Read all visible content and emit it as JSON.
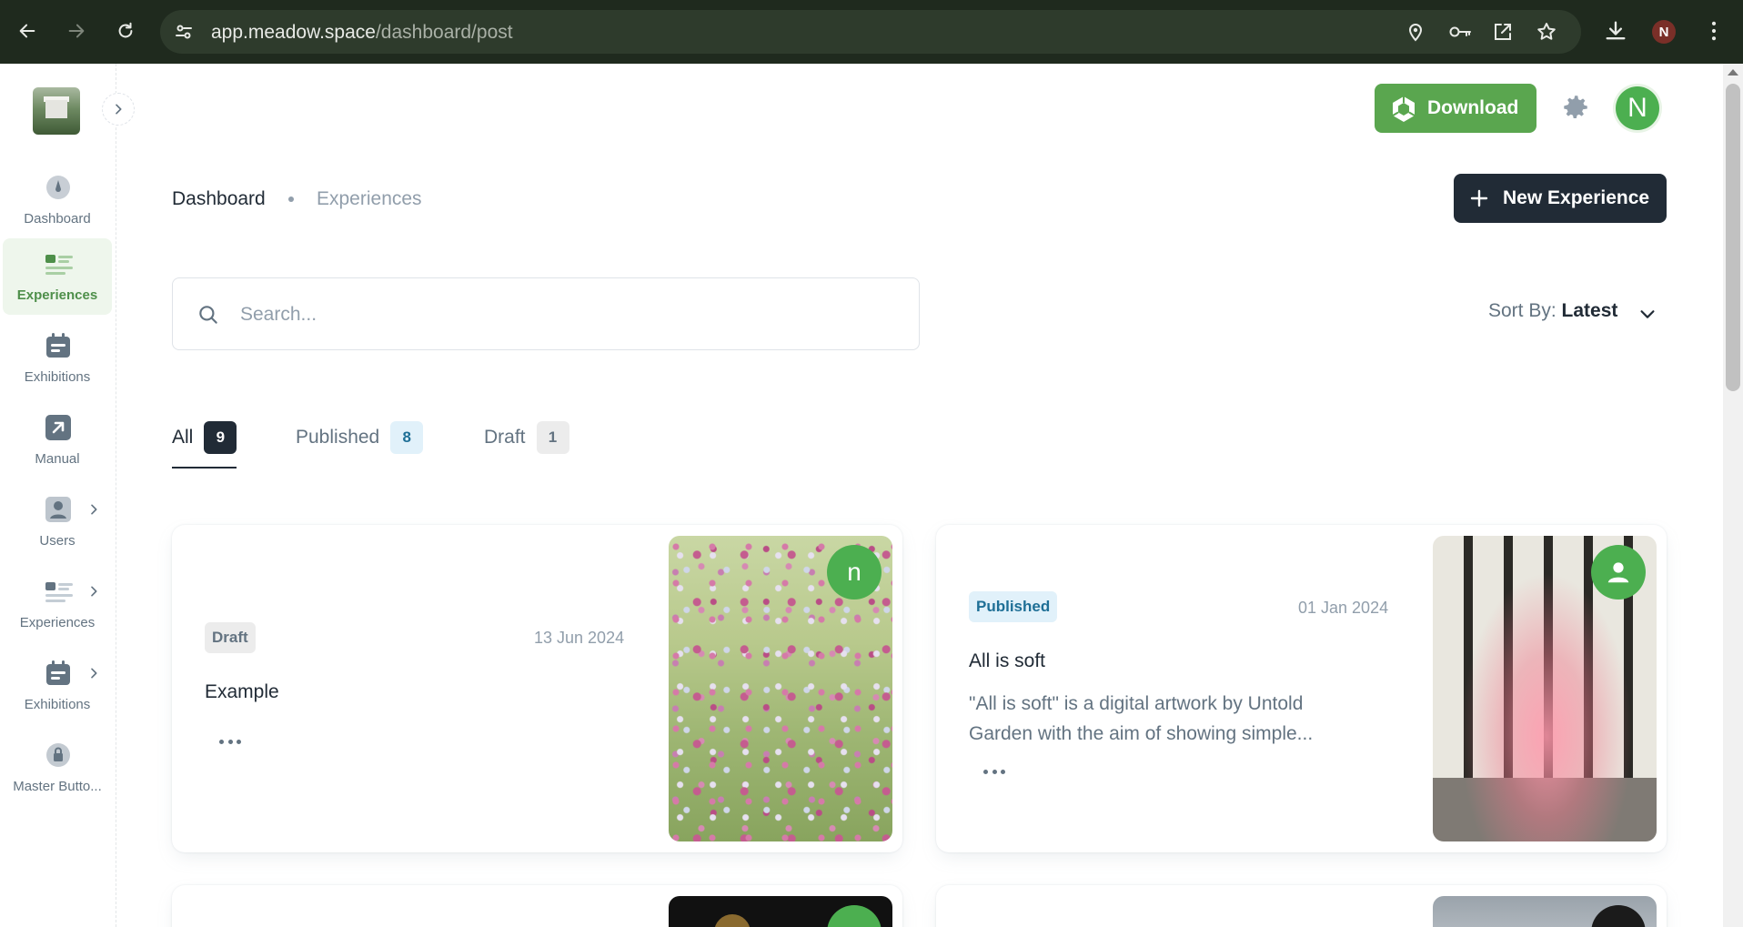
{
  "browser": {
    "url_host": "app.meadow.space",
    "url_path": "/dashboard/post",
    "profile_initial": "N"
  },
  "sidebar": {
    "items": [
      {
        "label": "Dashboard",
        "icon": "gauge-icon"
      },
      {
        "label": "Experiences",
        "icon": "list-icon",
        "active": true
      },
      {
        "label": "Exhibitions",
        "icon": "calendar-icon"
      },
      {
        "label": "Manual",
        "icon": "external-link-icon"
      },
      {
        "label": "Users",
        "icon": "user-icon"
      },
      {
        "label": "Experiences",
        "icon": "list-icon"
      },
      {
        "label": "Exhibitions",
        "icon": "calendar-icon"
      },
      {
        "label": "Master Butto...",
        "icon": "lock-icon"
      }
    ]
  },
  "header": {
    "download_label": "Download",
    "avatar_initial": "N"
  },
  "breadcrumb": {
    "root": "Dashboard",
    "current": "Experiences"
  },
  "actions": {
    "new_experience_label": "New Experience"
  },
  "search": {
    "placeholder": "Search..."
  },
  "sort": {
    "label": "Sort By:",
    "value": "Latest"
  },
  "tabs": [
    {
      "label": "All",
      "count": "9"
    },
    {
      "label": "Published",
      "count": "8"
    },
    {
      "label": "Draft",
      "count": "1"
    }
  ],
  "cards": [
    {
      "status": "Draft",
      "date": "13 Jun 2024",
      "title": "Example",
      "description": "",
      "author_initial": "n"
    },
    {
      "status": "Published",
      "date": "01 Jan 2024",
      "title": "All is soft",
      "description": "\"All is soft\" is a digital artwork by Untold Garden with the aim of showing simple..."
    }
  ],
  "colors": {
    "brand_green": "#5aa64f",
    "dark": "#212b36",
    "published_badge_bg": "#e1f1fa",
    "draft_badge_bg": "#ececec"
  }
}
